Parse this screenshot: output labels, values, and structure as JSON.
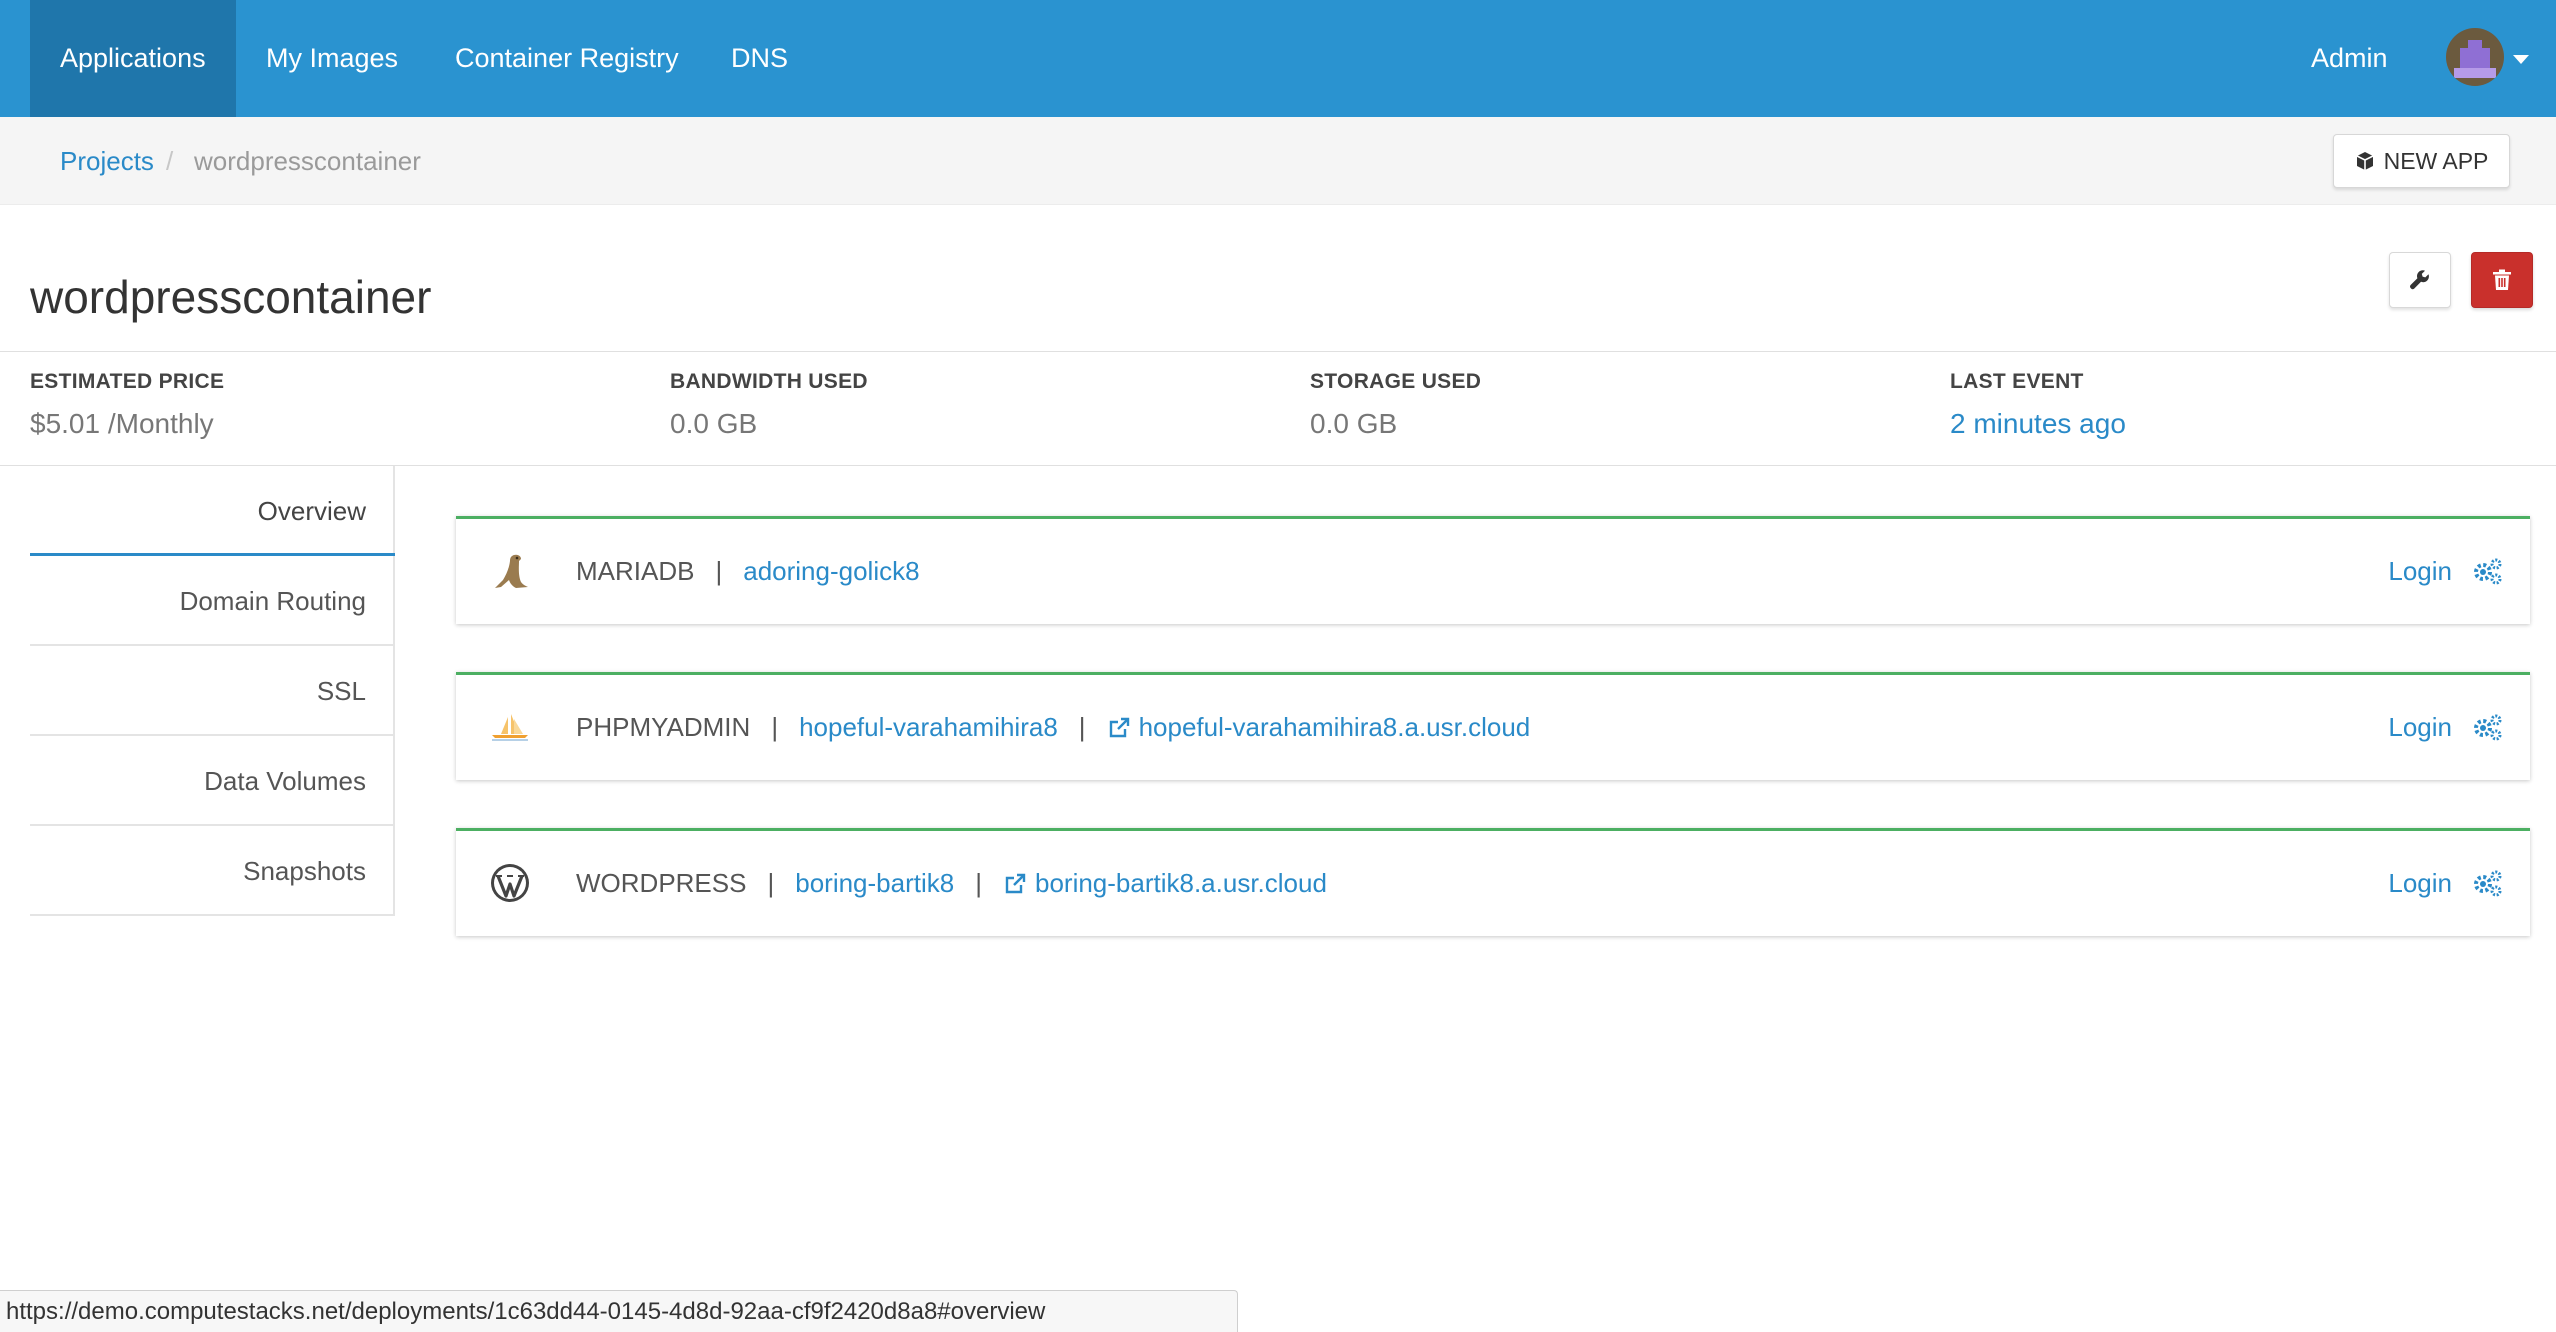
{
  "nav": {
    "items": [
      {
        "label": "Applications",
        "active": true
      },
      {
        "label": "My Images",
        "active": false
      },
      {
        "label": "Container Registry",
        "active": false
      },
      {
        "label": "DNS",
        "active": false
      }
    ],
    "admin_label": "Admin"
  },
  "breadcrumb": {
    "root": "Projects",
    "separator": "/",
    "current": "wordpresscontainer"
  },
  "new_app_label": "NEW APP",
  "page_title": "wordpresscontainer",
  "stats": [
    {
      "label": "ESTIMATED PRICE",
      "value": "$5.01 /Monthly"
    },
    {
      "label": "BANDWIDTH USED",
      "value": "0.0 GB"
    },
    {
      "label": "STORAGE USED",
      "value": "0.0 GB"
    },
    {
      "label": "LAST EVENT",
      "value": "2 minutes ago"
    }
  ],
  "side_menu": [
    {
      "label": "Overview",
      "active": true
    },
    {
      "label": "Domain Routing",
      "active": false
    },
    {
      "label": "SSL",
      "active": false
    },
    {
      "label": "Data Volumes",
      "active": false
    },
    {
      "label": "Snapshots",
      "active": false
    }
  ],
  "services": [
    {
      "icon": "sea-lion-icon",
      "name": "MARIADB",
      "container": "adoring-golick8",
      "domain": "",
      "login_label": "Login"
    },
    {
      "icon": "sailboat-icon",
      "name": "PHPMYADMIN",
      "container": "hopeful-varahamihira8",
      "domain": "hopeful-varahamihira8.a.usr.cloud",
      "login_label": "Login"
    },
    {
      "icon": "wordpress-icon",
      "name": "WORDPRESS",
      "container": "boring-bartik8",
      "domain": "boring-bartik8.a.usr.cloud",
      "login_label": "Login"
    }
  ],
  "status_url": "https://demo.computestacks.net/deployments/1c63dd44-0145-4d8d-92aa-cf9f2420d8a8#overview",
  "colors": {
    "nav_bg": "#2a93d0",
    "nav_active_bg": "#1f76ab",
    "link": "#2a8ac8",
    "card_accent": "#4caf62",
    "danger": "#c9302c"
  }
}
